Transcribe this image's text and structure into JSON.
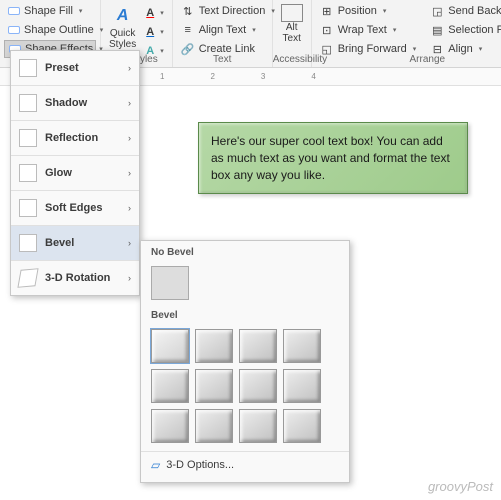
{
  "ribbon": {
    "shape_fill": "Shape Fill",
    "shape_outline": "Shape Outline",
    "shape_effects": "Shape Effects",
    "quick_styles": "Quick\nStyles",
    "artstyles_label": "Art Styles",
    "text_direction": "Text Direction",
    "align_text": "Align Text",
    "create_link": "Create Link",
    "text_label": "Text",
    "alt_text": "Alt\nText",
    "accessibility_label": "Accessibility",
    "position": "Position",
    "wrap_text": "Wrap Text",
    "bring_forward": "Bring Forward",
    "send_backward": "Send Backward",
    "selection_pane": "Selection Pane",
    "align": "Align",
    "arrange_label": "Arrange"
  },
  "ruler": {
    "m1": "1",
    "m2": "2",
    "m3": "3",
    "m4": "4"
  },
  "textbox": {
    "content": "Here's our super cool text box! You can add as much text as you want and format the text box any way you like."
  },
  "effects_menu": {
    "preset": "Preset",
    "shadow": "Shadow",
    "reflection": "Reflection",
    "glow": "Glow",
    "soft_edges": "Soft Edges",
    "bevel": "Bevel",
    "rotation3d": "3-D Rotation"
  },
  "bevel_menu": {
    "no_bevel_hdr": "No Bevel",
    "bevel_hdr": "Bevel",
    "options": "3-D Options..."
  },
  "watermark": "groovyPost"
}
